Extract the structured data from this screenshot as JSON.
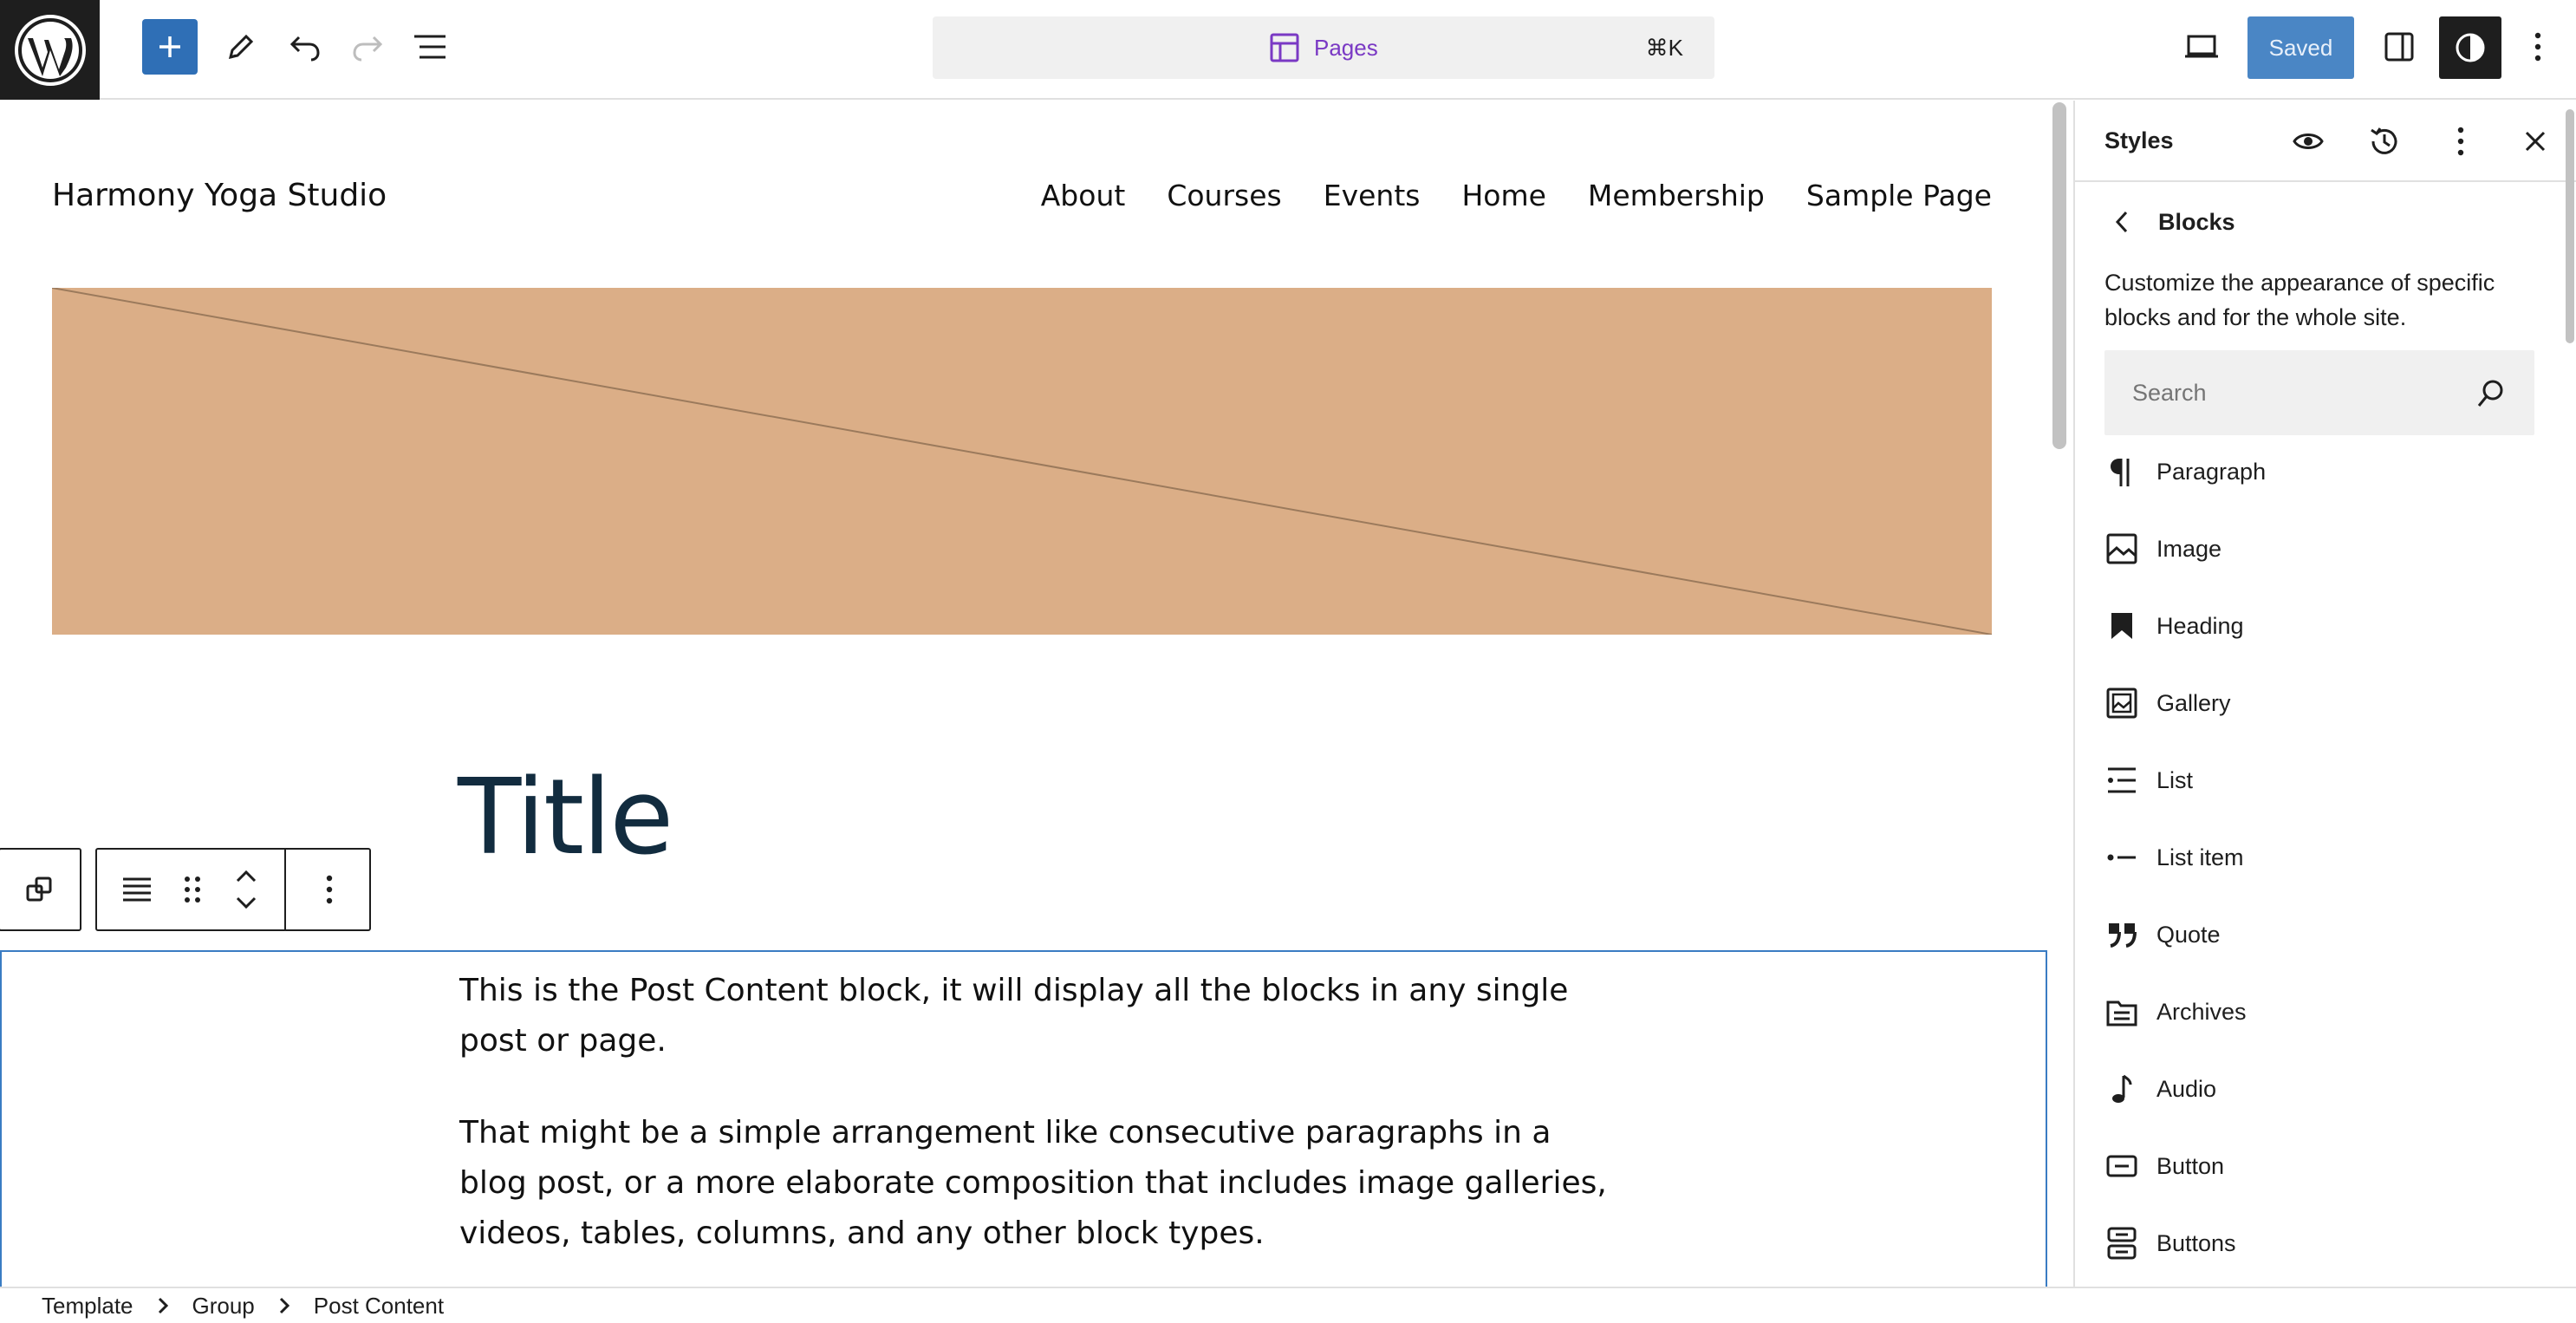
{
  "toolbar": {
    "command_label": "Pages",
    "command_shortcut": "⌘K",
    "saved_label": "Saved",
    "accent_color": "#2f6fb6"
  },
  "site": {
    "title": "Harmony Yoga Studio",
    "nav": [
      "About",
      "Courses",
      "Events",
      "Home",
      "Membership",
      "Sample Page"
    ],
    "hero_color": "#dbae87"
  },
  "post": {
    "title": "Title",
    "paragraphs": [
      "This is the Post Content block, it will display all the blocks in any single post or page.",
      "That might be a simple arrangement like consecutive paragraphs in a blog post, or a more elaborate composition that includes image galleries, videos, tables, columns, and any other block types."
    ]
  },
  "breadcrumb": [
    "Template",
    "Group",
    "Post Content"
  ],
  "sidebar": {
    "title": "Styles",
    "section_title": "Blocks",
    "description": "Customize the appearance of specific blocks and for the whole site.",
    "search_placeholder": "Search",
    "blocks": [
      {
        "label": "Paragraph",
        "icon": "paragraph-icon"
      },
      {
        "label": "Image",
        "icon": "image-icon"
      },
      {
        "label": "Heading",
        "icon": "heading-icon"
      },
      {
        "label": "Gallery",
        "icon": "gallery-icon"
      },
      {
        "label": "List",
        "icon": "list-icon"
      },
      {
        "label": "List item",
        "icon": "list-item-icon"
      },
      {
        "label": "Quote",
        "icon": "quote-icon"
      },
      {
        "label": "Archives",
        "icon": "archives-icon"
      },
      {
        "label": "Audio",
        "icon": "audio-icon"
      },
      {
        "label": "Button",
        "icon": "button-icon"
      },
      {
        "label": "Buttons",
        "icon": "buttons-icon"
      }
    ]
  }
}
